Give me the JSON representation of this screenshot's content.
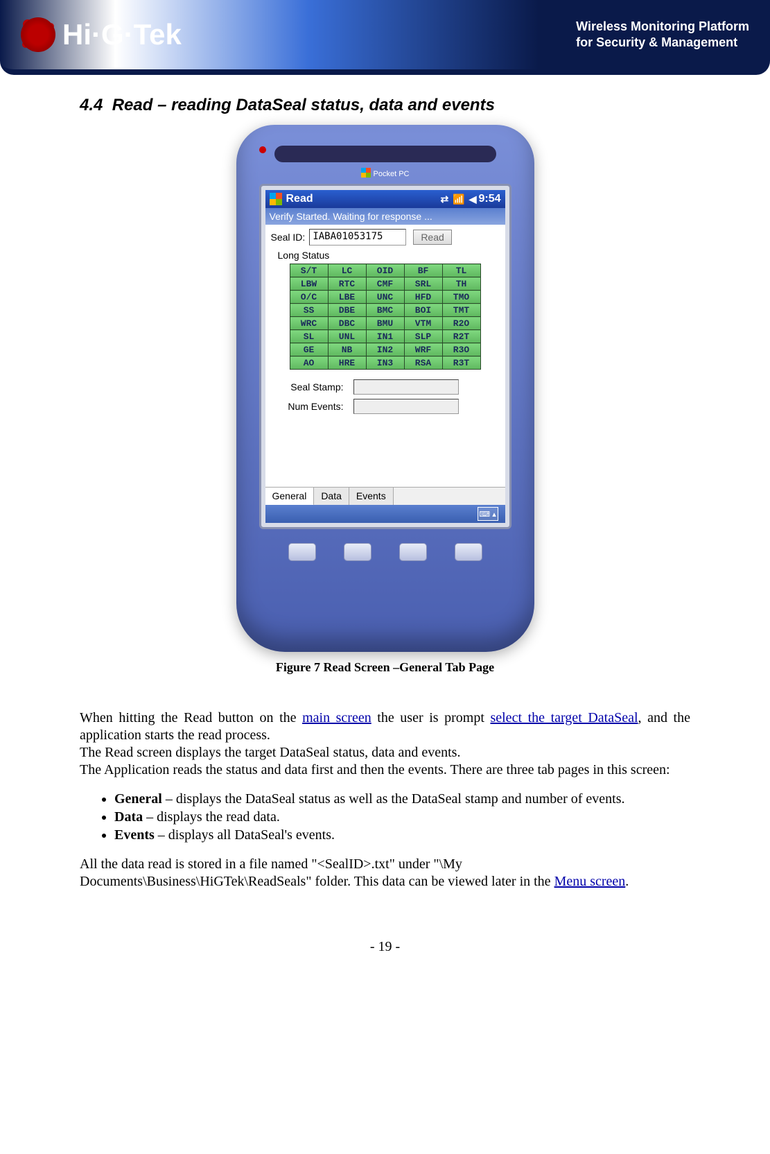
{
  "header": {
    "brand": "Hi·G·Tek",
    "tagline_line1": "Wireless Monitoring Platform",
    "tagline_line2": "for Security & Management"
  },
  "section": {
    "number": "4.4",
    "title": "Read – reading DataSeal status, data and events"
  },
  "device": {
    "pocketpc_label": "Pocket PC",
    "titlebar": {
      "app_name": "Read",
      "time": "9:54"
    },
    "status_message": "Verify Started. Waiting for response ...",
    "seal_id_label": "Seal ID:",
    "seal_id_value": "IABA01053175",
    "read_button": "Read",
    "long_status_label": "Long Status",
    "status_grid": [
      [
        "S/T",
        "LC",
        "OID",
        "BF",
        "TL"
      ],
      [
        "LBW",
        "RTC",
        "CMF",
        "SRL",
        "TH"
      ],
      [
        "O/C",
        "LBE",
        "UNC",
        "HFD",
        "TMO"
      ],
      [
        "SS",
        "DBE",
        "BMC",
        "BOI",
        "TMT"
      ],
      [
        "WRC",
        "DBC",
        "BMU",
        "VTM",
        "R2O"
      ],
      [
        "SL",
        "UNL",
        "IN1",
        "SLP",
        "R2T"
      ],
      [
        "GE",
        "NB",
        "IN2",
        "WRF",
        "R3O"
      ],
      [
        "AO",
        "HRE",
        "IN3",
        "RSA",
        "R3T"
      ]
    ],
    "seal_stamp_label": "Seal Stamp:",
    "num_events_label": "Num Events:",
    "tabs": {
      "general": "General",
      "data": "Data",
      "events": "Events"
    }
  },
  "figure_caption": "Figure 7 Read Screen –General Tab Page",
  "paragraphs": {
    "p1_a": "When hitting the Read button on the ",
    "p1_link1": "main screen",
    "p1_b": " the user is prompt ",
    "p1_link2": "select the target DataSeal",
    "p1_c": ", and the application starts the read process.",
    "p2": "The Read screen displays the target DataSeal status, data and events.",
    "p3": "The Application reads the status and data first and then the events. There are three tab pages in this screen:"
  },
  "bullets": {
    "general_name": "General",
    "general_desc": " – displays the DataSeal status as well as the DataSeal stamp and number of events.",
    "data_name": "Data",
    "data_desc": " – displays the read data.",
    "events_name": "Events",
    "events_desc": " – displays all DataSeal's events."
  },
  "closing": {
    "a": "All the data read is stored in a file named \"<SealID>.txt\" under \"\\My Documents\\Business\\HiGTek\\ReadSeals\" folder. This data can be viewed later in the ",
    "link": "Menu screen",
    "b": "."
  },
  "page_number": "- 19 -"
}
